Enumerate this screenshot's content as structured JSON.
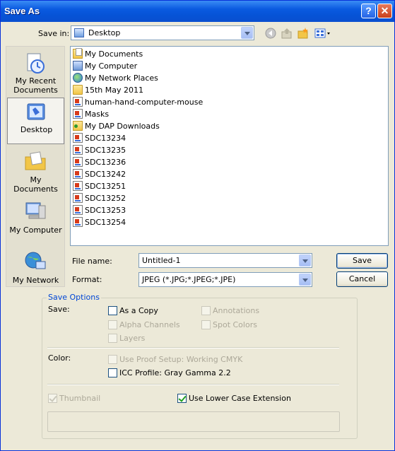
{
  "window": {
    "title": "Save As",
    "help_label": "?",
    "close_label": "✕"
  },
  "save_in": {
    "label": "Save in:",
    "value": "Desktop"
  },
  "toolbar": {
    "icons": [
      "back-icon",
      "up-folder-icon",
      "new-folder-icon",
      "views-menu-icon"
    ]
  },
  "places": [
    {
      "label_line1": "My Recent",
      "label_line2": "Documents"
    },
    {
      "label_line1": "Desktop",
      "label_line2": ""
    },
    {
      "label_line1": "My Documents",
      "label_line2": ""
    },
    {
      "label_line1": "My Computer",
      "label_line2": ""
    },
    {
      "label_line1": "My Network",
      "label_line2": ""
    }
  ],
  "files": [
    {
      "name": "My Documents",
      "icon": "mydocs"
    },
    {
      "name": "My Computer",
      "icon": "comp"
    },
    {
      "name": "My Network Places",
      "icon": "net"
    },
    {
      "name": "15th May 2011",
      "icon": "folder"
    },
    {
      "name": "human-hand-computer-mouse",
      "icon": "doc"
    },
    {
      "name": "Masks",
      "icon": "doc"
    },
    {
      "name": "My DAP Downloads",
      "icon": "dap"
    },
    {
      "name": "SDC13234",
      "icon": "doc"
    },
    {
      "name": "SDC13235",
      "icon": "doc"
    },
    {
      "name": "SDC13236",
      "icon": "doc"
    },
    {
      "name": "SDC13242",
      "icon": "doc"
    },
    {
      "name": "SDC13251",
      "icon": "doc"
    },
    {
      "name": "SDC13252",
      "icon": "doc"
    },
    {
      "name": "SDC13253",
      "icon": "doc"
    },
    {
      "name": "SDC13254",
      "icon": "doc"
    }
  ],
  "file_name": {
    "label": "File name:",
    "value": "Untitled-1"
  },
  "format": {
    "label": "Format:",
    "value": "JPEG (*.JPG;*.JPEG;*.JPE)"
  },
  "buttons": {
    "save": "Save",
    "cancel": "Cancel"
  },
  "save_options": {
    "legend": "Save Options",
    "save_label": "Save:",
    "as_a_copy": {
      "label": "As a Copy",
      "checked": false,
      "enabled": true
    },
    "annotations": {
      "label": "Annotations",
      "checked": false,
      "enabled": false
    },
    "alpha_channels": {
      "label": "Alpha Channels",
      "checked": false,
      "enabled": false
    },
    "spot_colors": {
      "label": "Spot Colors",
      "checked": false,
      "enabled": false
    },
    "layers": {
      "label": "Layers",
      "checked": false,
      "enabled": false
    },
    "color_label": "Color:",
    "use_proof_setup": {
      "label": "Use Proof Setup:  Working CMYK",
      "checked": false,
      "enabled": false
    },
    "icc_profile": {
      "label": "ICC Profile:  Gray Gamma 2.2",
      "checked": false,
      "enabled": true
    },
    "thumbnail": {
      "label": "Thumbnail",
      "checked": true,
      "enabled": false
    },
    "lower_case_ext": {
      "label": "Use Lower Case Extension",
      "checked": true,
      "enabled": true
    }
  }
}
